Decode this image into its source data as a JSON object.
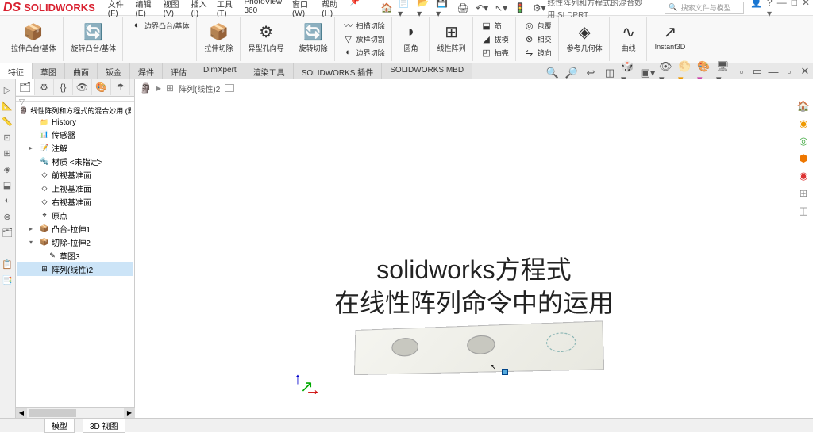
{
  "app": {
    "name": "SOLIDWORKS",
    "doc_name": "线性阵列和方程式的混合妙用.SLDPRT",
    "search_placeholder": "搜索文件与模型"
  },
  "menu": [
    "文件(F)",
    "编辑(E)",
    "视图(V)",
    "插入(I)",
    "工具(T)",
    "PhotoView 360",
    "窗口(W)",
    "帮助(H)"
  ],
  "ribbon": {
    "extrude_boss": "拉伸凸台/基体",
    "revolve_boss": "旋转凸台/基体",
    "boundary_boss": "边界凸台/基体",
    "extrude_cut": "拉伸切除",
    "hole_wizard": "异型孔向导",
    "revolve_cut": "旋转切除",
    "swept_cut": "扫描切除",
    "loft_cut": "放样切割",
    "boundary_cut": "边界切除",
    "fillet": "圆角",
    "linear_pattern": "线性阵列",
    "rib": "筋",
    "draft": "拔模",
    "shell": "抽壳",
    "wrap": "包覆",
    "intersect": "相交",
    "mirror": "镜向",
    "ref_geom": "参考几何体",
    "curves": "曲线",
    "instant3d": "Instant3D"
  },
  "tabs": [
    "特征",
    "草图",
    "曲面",
    "钣金",
    "焊件",
    "评估",
    "DimXpert",
    "渲染工具",
    "SOLIDWORKS 插件",
    "SOLIDWORKS MBD"
  ],
  "tree": {
    "root": "线性阵列和方程式的混合妙用 (默认<<默...",
    "items": [
      {
        "label": "History",
        "indent": 1,
        "icon": "📁"
      },
      {
        "label": "传感器",
        "indent": 1,
        "icon": "📊"
      },
      {
        "label": "注解",
        "indent": 1,
        "icon": "📝",
        "expandable": true
      },
      {
        "label": "材质 <未指定>",
        "indent": 1,
        "icon": "🔩"
      },
      {
        "label": "前视基准面",
        "indent": 1,
        "icon": "◇"
      },
      {
        "label": "上视基准面",
        "indent": 1,
        "icon": "◇"
      },
      {
        "label": "右视基准面",
        "indent": 1,
        "icon": "◇"
      },
      {
        "label": "原点",
        "indent": 1,
        "icon": "⌖"
      },
      {
        "label": "凸台-拉伸1",
        "indent": 1,
        "icon": "📦",
        "expandable": true
      },
      {
        "label": "切除-拉伸2",
        "indent": 1,
        "icon": "📦",
        "expandable": true,
        "expanded": true
      },
      {
        "label": "草图3",
        "indent": 2,
        "icon": "✎"
      },
      {
        "label": "阵列(线性)2",
        "indent": 1,
        "icon": "⊞",
        "selected": true
      }
    ]
  },
  "breadcrumb": "阵列(线性)2",
  "overlay": {
    "line1": "solidworks方程式",
    "line2": "在线性阵列命令中的运用"
  },
  "status": {
    "tab1": "模型",
    "tab2": "3D 视图"
  }
}
